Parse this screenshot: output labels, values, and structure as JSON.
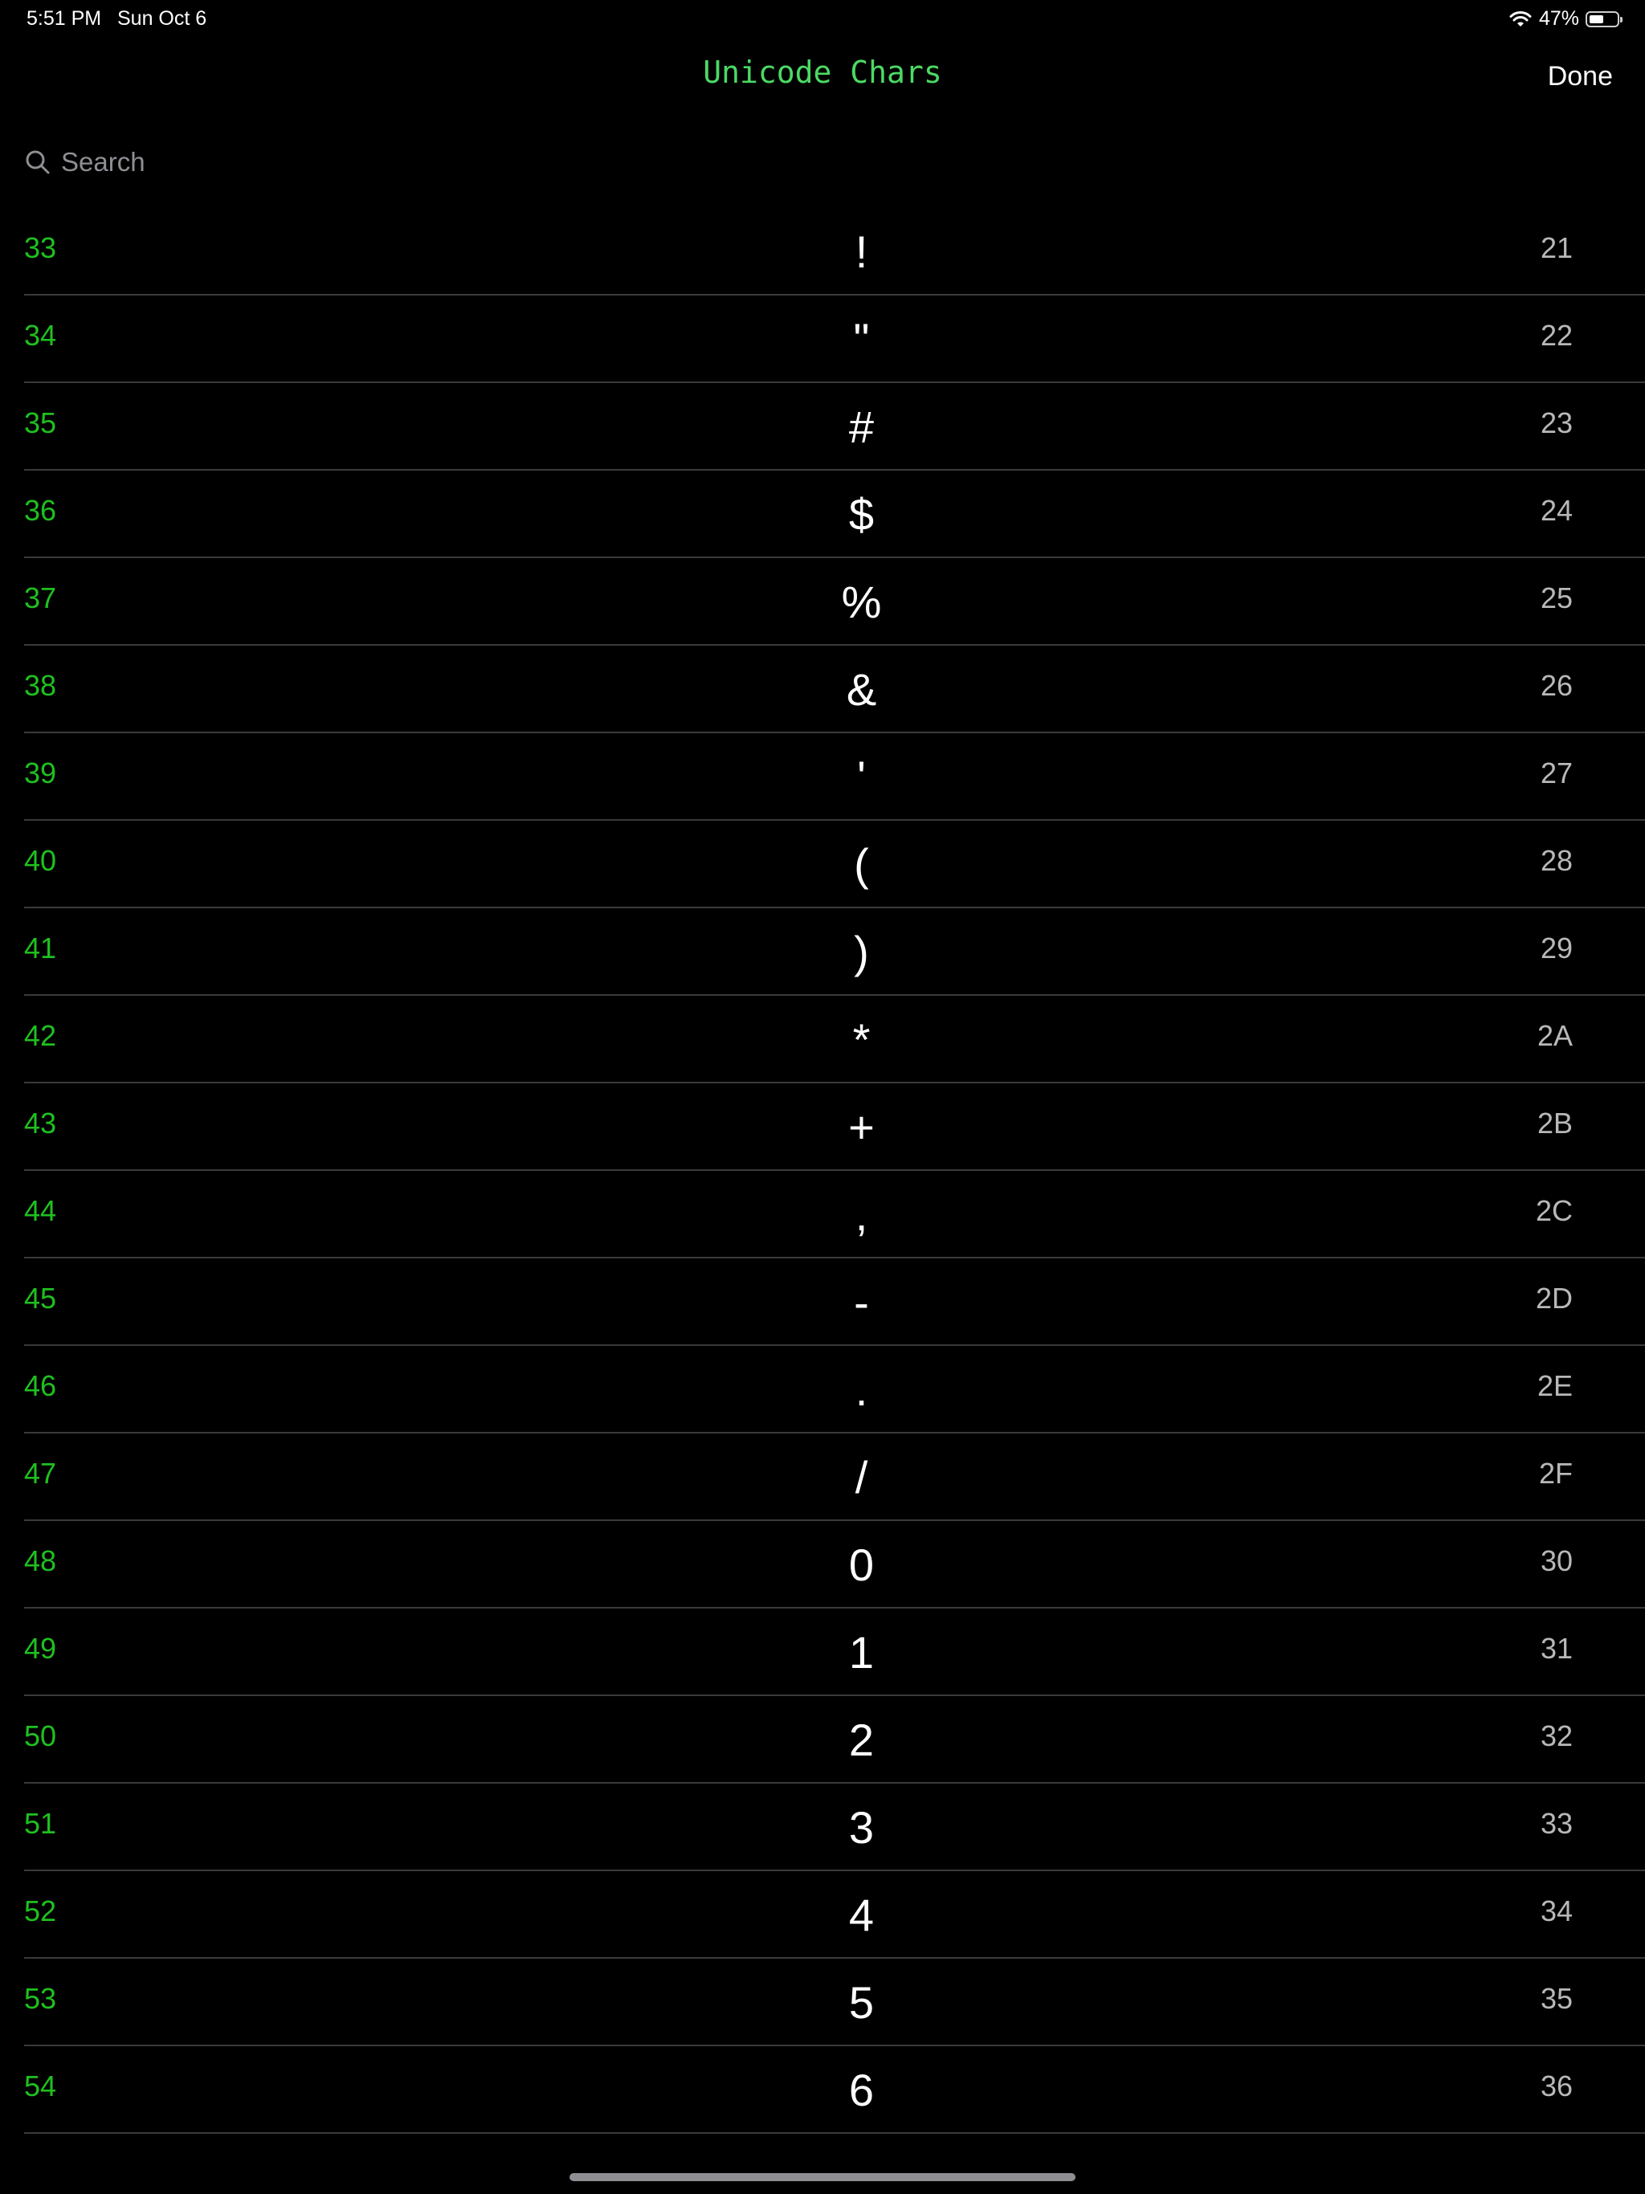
{
  "status_bar": {
    "time": "5:51 PM",
    "date": "Sun Oct 6",
    "battery_percent": "47%",
    "battery_level": 0.47
  },
  "nav": {
    "title": "Unicode Chars",
    "done_label": "Done"
  },
  "search": {
    "placeholder": "Search",
    "value": ""
  },
  "rows": [
    {
      "dec": "33",
      "char": "!",
      "hex": "21"
    },
    {
      "dec": "34",
      "char": "\"",
      "hex": "22"
    },
    {
      "dec": "35",
      "char": "#",
      "hex": "23"
    },
    {
      "dec": "36",
      "char": "$",
      "hex": "24"
    },
    {
      "dec": "37",
      "char": "%",
      "hex": "25"
    },
    {
      "dec": "38",
      "char": "&",
      "hex": "26"
    },
    {
      "dec": "39",
      "char": "'",
      "hex": "27"
    },
    {
      "dec": "40",
      "char": "(",
      "hex": "28"
    },
    {
      "dec": "41",
      "char": ")",
      "hex": "29"
    },
    {
      "dec": "42",
      "char": "*",
      "hex": "2A"
    },
    {
      "dec": "43",
      "char": "+",
      "hex": "2B"
    },
    {
      "dec": "44",
      "char": ",",
      "hex": "2C"
    },
    {
      "dec": "45",
      "char": "-",
      "hex": "2D"
    },
    {
      "dec": "46",
      "char": ".",
      "hex": "2E"
    },
    {
      "dec": "47",
      "char": "/",
      "hex": "2F"
    },
    {
      "dec": "48",
      "char": "0",
      "hex": "30"
    },
    {
      "dec": "49",
      "char": "1",
      "hex": "31"
    },
    {
      "dec": "50",
      "char": "2",
      "hex": "32"
    },
    {
      "dec": "51",
      "char": "3",
      "hex": "33"
    },
    {
      "dec": "52",
      "char": "4",
      "hex": "34"
    },
    {
      "dec": "53",
      "char": "5",
      "hex": "35"
    },
    {
      "dec": "54",
      "char": "6",
      "hex": "36"
    }
  ],
  "colors": {
    "title": "#4cd964",
    "decimal": "#1fc01f",
    "hex": "#b8b8b8",
    "separator": "#3a3a3c",
    "background": "#000000"
  },
  "icons": {
    "search": "search-icon",
    "wifi": "wifi-icon",
    "battery": "battery-icon"
  }
}
